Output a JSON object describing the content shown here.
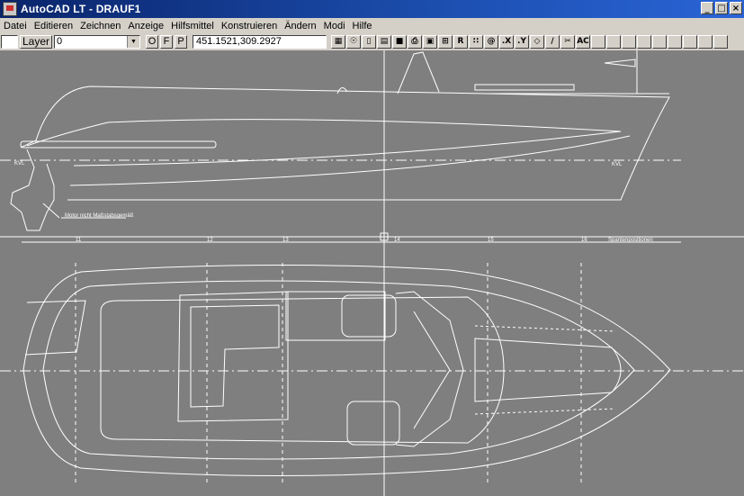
{
  "window": {
    "title": "AutoCAD LT - DRAUF1",
    "controls": [
      "_",
      "□",
      "×"
    ]
  },
  "menu": {
    "items": [
      "Datei",
      "Editieren",
      "Zeichnen",
      "Anzeige",
      "Hilfsmittel",
      "Konstruieren",
      "Ändern",
      "Modi",
      "Hilfe"
    ]
  },
  "toolbar": {
    "layer_label": "Layer",
    "layer_value": "0",
    "mode_buttons": [
      "O",
      "F",
      "P"
    ],
    "coordinates": "451.1521,309.2927",
    "tool_icons": [
      "grid-icon",
      "snap-icon",
      "new-file-icon",
      "open-file-icon",
      "save-icon",
      "print-icon",
      "redraw-icon",
      "zoom-icon",
      "regen-icon",
      "snap-grid-icon",
      "point-icon",
      "x-filter-icon",
      "y-filter-icon",
      "erase-icon",
      "edit-icon",
      "scissors-icon",
      "text-icon"
    ],
    "tool_glyphs": [
      "▦",
      "☉",
      "▯",
      "▤",
      "■",
      "⎙",
      "▣",
      "⊞",
      "R",
      "∷",
      "@",
      ".X",
      ".Y",
      "◇",
      "∕",
      "✂",
      "AC"
    ],
    "empty_slots": 9
  },
  "drawing": {
    "background": "#7f7f7f",
    "line_color": "#ffffff",
    "labels": {
      "kvl_left": "KVL",
      "kvl_right": "KVL",
      "motor_note": "Motor nicht Maßstabsgemäß",
      "station_labels": [
        "11",
        "12",
        "13",
        "14",
        "15",
        "16"
      ],
      "station_title": "Spantenpositionen"
    }
  }
}
